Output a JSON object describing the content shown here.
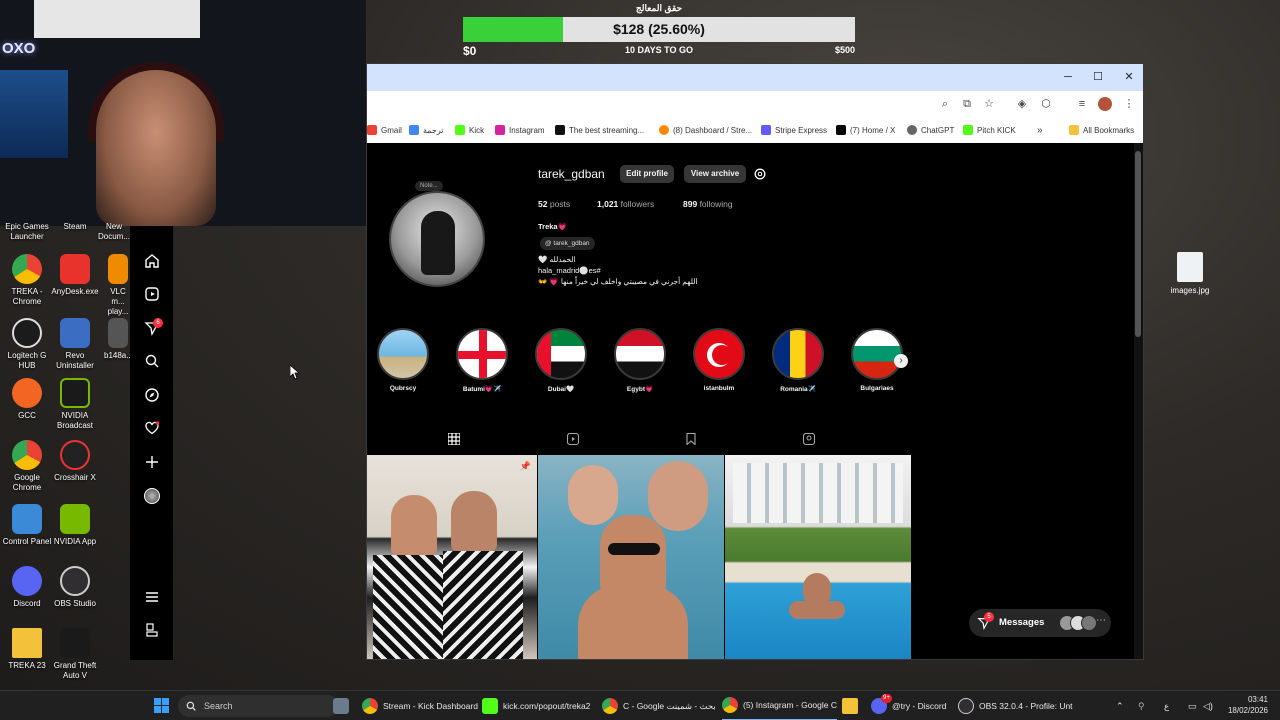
{
  "donation": {
    "title": "حقق المعالج",
    "amount_text": "$128 (25.60%)",
    "progress_fraction": 0.256,
    "min": "$0",
    "max": "$500",
    "days_left": "10 DAYS TO GO",
    "fill_color": "#3ad03a"
  },
  "webcam": {
    "logo": "OXO"
  },
  "desktop_icons": [
    {
      "label": "Epic Games Launcher"
    },
    {
      "label": "Steam"
    },
    {
      "label": "New Docum..."
    },
    {
      "label": "TREKA - Chrome"
    },
    {
      "label": "AnyDesk.exe"
    },
    {
      "label": "VLC m... play..."
    },
    {
      "label": "Logitech G HUB"
    },
    {
      "label": "Revo Uninstaller"
    },
    {
      "label": "b148a..."
    },
    {
      "label": "GCC"
    },
    {
      "label": "NVIDIA Broadcast"
    },
    {
      "label": "Google Chrome"
    },
    {
      "label": "Crosshair X"
    },
    {
      "label": "Control Panel"
    },
    {
      "label": "NVIDIA App"
    },
    {
      "label": "Discord"
    },
    {
      "label": "OBS Studio"
    },
    {
      "label": "TREKA 23"
    },
    {
      "label": "Grand Theft Auto V"
    }
  ],
  "desktop_file": {
    "label": "images.jpg"
  },
  "browser": {
    "bookmarks": [
      "Gmail",
      "ترجمة",
      "Kick",
      "Instagram",
      "The best streaming...",
      "(8) Dashboard / Stre...",
      "Stripe Express",
      "(7) Home / X",
      "ChatGPT",
      "Pitch KICK"
    ],
    "all_bookmarks": "All Bookmarks",
    "more_chevron": "»"
  },
  "instagram": {
    "note": "Note...",
    "username": "tarek_gdban",
    "edit_profile": "Edit profile",
    "view_archive": "View archive",
    "posts_count": "52",
    "posts_label": "posts",
    "followers_count": "1,021",
    "followers_label": "followers",
    "following_count": "899",
    "following_label": "following",
    "display_name": "Treka💗",
    "threads_handle": "tarek_gdban",
    "bio_line1": "🤍 الحمدلله",
    "bio_line2": "hala_madrid⚪es#",
    "bio_line3": "👐 💗 اللهم أجرني في مصيبتي واخلف لي خيراً منها",
    "notification_count": "6",
    "highlights": [
      {
        "label": "Qubrscy"
      },
      {
        "label": "Batumi💗✈️"
      },
      {
        "label": "Dubai🤍"
      },
      {
        "label": "Egybt💗"
      },
      {
        "label": "istanbulm"
      },
      {
        "label": "Romania✈️"
      },
      {
        "label": "Bulgariaes"
      }
    ],
    "messages_label": "Messages",
    "messages_badge": "5"
  },
  "taskbar": {
    "search_placeholder": "Search",
    "items": [
      {
        "label": "Stream - Kick Dashboard"
      },
      {
        "label": "kick.com/popout/treka2"
      },
      {
        "label": "C - Google بحث - شمينت"
      },
      {
        "label": "(5) Instagram - Google C"
      },
      {
        "label": "@try - Discord"
      },
      {
        "label": "OBS 32.0.4 - Profile: Unt"
      }
    ],
    "discord_badge": "9+",
    "lang": "ع",
    "time": "03:41",
    "date": "18/02/2026"
  }
}
